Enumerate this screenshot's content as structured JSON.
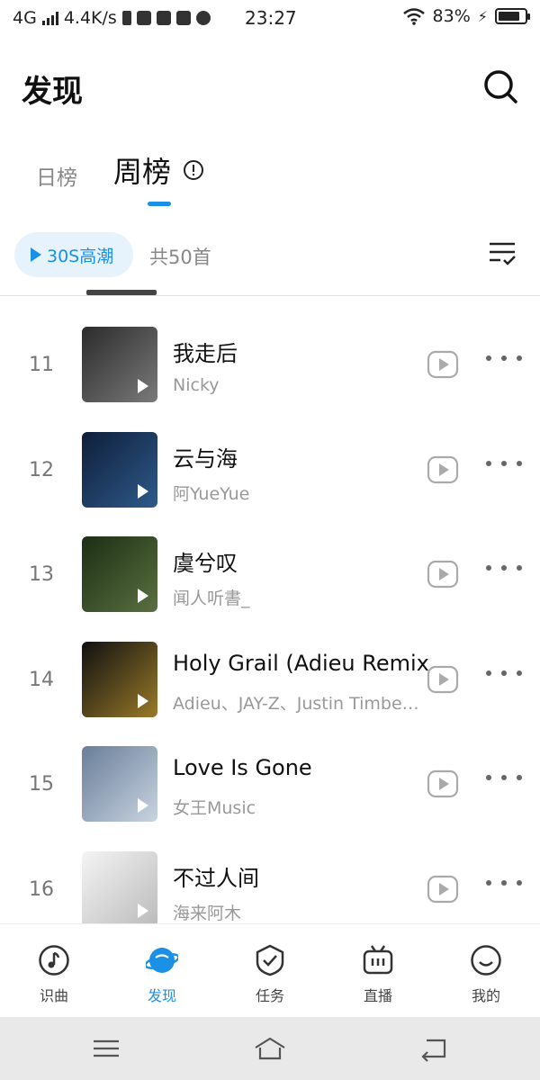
{
  "status_bar": {
    "network": "4G",
    "speed": "4.4K/s",
    "time": "23:27",
    "battery": "83%",
    "battery_level": 0.83
  },
  "header": {
    "title": "发现",
    "search_icon": "search-icon"
  },
  "tabs": [
    {
      "label": "日榜",
      "active": false
    },
    {
      "label": "周榜",
      "active": true
    }
  ],
  "play_bar": {
    "highlight_label": "30S高潮",
    "count_text": "共50首",
    "sort_icon": "sort-list-icon"
  },
  "songs": [
    {
      "rank": "11",
      "title": "我走后",
      "artist": "Nicky",
      "cover_colors": [
        "#2b2b2b",
        "#7a7a7a"
      ]
    },
    {
      "rank": "12",
      "title": "云与海",
      "artist": "阿YueYue",
      "cover_colors": [
        "#0e1e3a",
        "#2e5a8a"
      ]
    },
    {
      "rank": "13",
      "title": "虞兮叹",
      "artist": "闻人听書_",
      "cover_colors": [
        "#1c2e14",
        "#5a7040"
      ]
    },
    {
      "rank": "14",
      "title": "Holy Grail (Adieu Remix)",
      "artist": "Adieu、JAY-Z、Justin Timberlake",
      "cover_colors": [
        "#101010",
        "#9a7a2a"
      ]
    },
    {
      "rank": "15",
      "title": "Love Is Gone",
      "artist": "女王Music",
      "cover_colors": [
        "#6a7e9a",
        "#c8d4e0"
      ]
    },
    {
      "rank": "16",
      "title": "不过人间",
      "artist": "海来阿木",
      "cover_colors": [
        "#f4f4f4",
        "#bbbbbb"
      ]
    }
  ],
  "bottom_nav": [
    {
      "label": "识曲",
      "icon": "music-note-icon",
      "active": false
    },
    {
      "label": "发现",
      "icon": "planet-icon",
      "active": true
    },
    {
      "label": "任务",
      "icon": "task-shield-icon",
      "active": false
    },
    {
      "label": "直播",
      "icon": "tv-icon",
      "active": false
    },
    {
      "label": "我的",
      "icon": "smiley-icon",
      "active": false
    }
  ],
  "colors": {
    "accent": "#1a90e6",
    "text_primary": "#111111",
    "text_secondary": "#999999"
  }
}
